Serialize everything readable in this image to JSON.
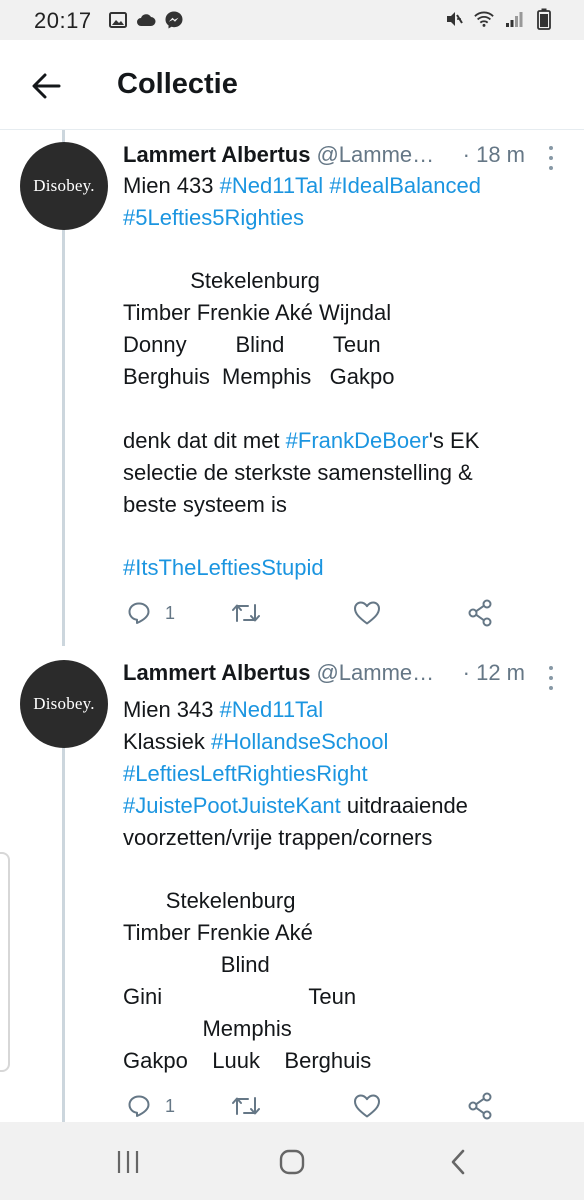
{
  "status_bar": {
    "time": "20:17",
    "left_icons": [
      "image-icon",
      "cloud-icon",
      "messenger-icon"
    ],
    "right_icons": [
      "mute-icon",
      "wifi-icon",
      "signal-icon",
      "battery-icon"
    ]
  },
  "header": {
    "title": "Collectie",
    "back_icon": "arrow-left-icon"
  },
  "colors": {
    "hashtag": "#1b95e0",
    "text": "#14171a",
    "muted": "#657786",
    "thread_line": "#ccd6dd",
    "avatar_bg": "#2b2b2b"
  },
  "tweets": [
    {
      "avatar_text": "Disobey.",
      "name": "Lammert Albertus",
      "handle": "@Lammert_Albertus",
      "time": "· 18 m",
      "reply_count": "1",
      "lines": {
        "l1": {
          "t1": "Mien 433 ",
          "h1": "#Ned11Tal",
          "t2": " ",
          "h2": "#IdealBalanced"
        },
        "l2": {
          "h1": "#5Lefties5Righties"
        },
        "l3": "           Stekelenburg",
        "l4": "Timber Frenkie Aké Wijndal",
        "l5": "Donny        Blind        Teun",
        "l6": "Berghuis  Memphis   Gakpo",
        "l7": {
          "t1": "denk dat dit met ",
          "h1": "#FrankDeBoer",
          "t2": "'s EK"
        },
        "l8": "selectie de sterkste samenstelling &",
        "l9": "beste systeem is",
        "l10": {
          "h1": "#ItsTheLeftiesStupid"
        }
      }
    },
    {
      "avatar_text": "Disobey.",
      "name": "Lammert Albertus",
      "handle": "@Lammert_Albertus",
      "time": "· 12 m",
      "reply_count": "1",
      "lines": {
        "l1": {
          "t1": "Mien 343 ",
          "h1": "#Ned11Tal"
        },
        "l2": {
          "t1": "Klassiek ",
          "h1": "#HollandseSchool"
        },
        "l3": {
          "h1": "#LeftiesLeftRightiesRight"
        },
        "l4": {
          "h1": "#JuistePootJuisteKant",
          "t1": " uitdraaiende"
        },
        "l5": "voorzetten/vrije trappen/corners",
        "l6": "       Stekelenburg",
        "l7": "Timber Frenkie Aké",
        "l8": "                Blind",
        "l9": "Gini                        Teun",
        "l10": "             Memphis",
        "l11": "Gakpo    Luuk    Berghuis"
      }
    }
  ],
  "nav": {
    "recents_icon": "recents-icon",
    "home_icon": "home-icon",
    "back_icon": "back-chevron-icon"
  }
}
